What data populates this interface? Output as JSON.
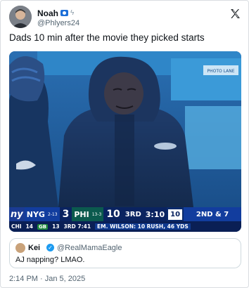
{
  "tweet": {
    "author_name": "Noah",
    "author_handle": "@Phlyers24",
    "text": "Dads 10 min after the movie they picked starts",
    "timestamp": "2:14 PM · Jan 5, 2025"
  },
  "icons": {
    "brand": "x-logo-icon",
    "affiliate": "flag-badge-icon",
    "emoji": "lightning-icon",
    "verified": "verified-check-icon"
  },
  "scoreboard": {
    "network": "ny",
    "away_team": "NYG",
    "away_record": "2-13",
    "away_score": "3",
    "home_team": "PHI",
    "home_record": "13-3",
    "home_score": "10",
    "quarter": "3RD",
    "clock": "3:10",
    "play_clock": "10",
    "down_distance": "2ND & 7",
    "ticker_team1": "CHI",
    "ticker_score1": "14",
    "ticker_team2": "GB",
    "ticker_score2": "13",
    "ticker_time": "3RD 7:41",
    "ticker_play": "EM. WILSON: 10 RUSH, 46 YDS",
    "overlay_logo": "PHOTO LANE"
  },
  "quote": {
    "author_name": "Kei",
    "author_handle": "@RealMamaEagle",
    "text": "AJ napping? LMAO."
  },
  "colors": {
    "scoreboard_navy": "#0b2a6b",
    "eagles_green": "#0b5a4e",
    "x_link_blue": "#1d9bf0"
  }
}
